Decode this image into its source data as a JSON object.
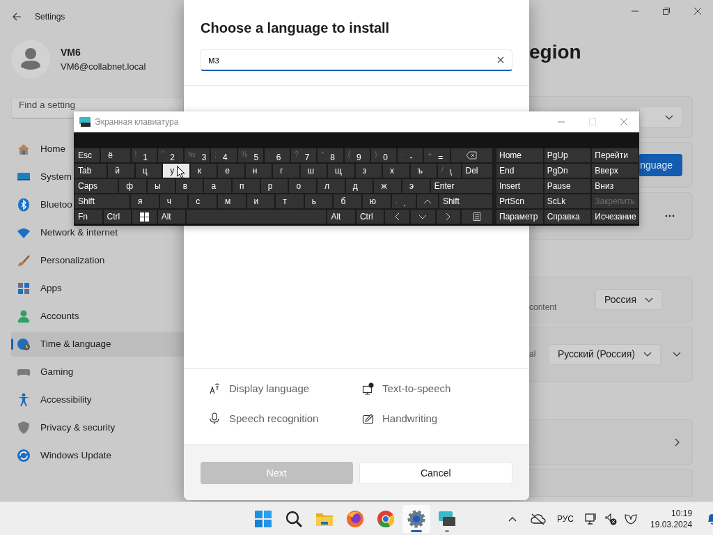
{
  "settings": {
    "title": "Settings",
    "user": {
      "name": "VM6",
      "email": "VM6@collabnet.local"
    },
    "search": {
      "placeholder": "Find a setting"
    },
    "nav": [
      {
        "label": "Home",
        "selected": false
      },
      {
        "label": "System",
        "selected": false
      },
      {
        "label": "Bluetoo",
        "selected": false
      },
      {
        "label": "Network & internet",
        "selected": false
      },
      {
        "label": "Personalization",
        "selected": false
      },
      {
        "label": "Apps",
        "selected": false
      },
      {
        "label": "Accounts",
        "selected": false
      },
      {
        "label": "Time & language",
        "selected": true
      },
      {
        "label": "Gaming",
        "selected": false
      },
      {
        "label": "Accessibility",
        "selected": false
      },
      {
        "label": "Privacy & security",
        "selected": false
      },
      {
        "label": "Windows Update",
        "selected": false
      }
    ],
    "page_title": "egion",
    "groups": [
      [
        {
          "kind": "dropdown"
        },
        {
          "kind": "button",
          "label": "nguage"
        },
        {
          "kind": "more"
        }
      ],
      [
        {
          "kind": "dropdown",
          "label": "content",
          "value": "Россия"
        },
        {
          "kind": "dropdown",
          "label": "al",
          "value": "Русский (Россия)",
          "expandable": true
        }
      ],
      [
        {
          "kind": "link"
        },
        {
          "kind": "blank"
        }
      ]
    ]
  },
  "dialog": {
    "title": "Choose a language to install",
    "search": {
      "value": "мз"
    },
    "features": [
      {
        "label": "Display language"
      },
      {
        "label": "Text-to-speech"
      },
      {
        "label": "Speech recognition"
      },
      {
        "label": "Handwriting"
      }
    ],
    "buttons": [
      {
        "label": "Next",
        "disabled": true
      },
      {
        "label": "Cancel",
        "disabled": false
      }
    ]
  },
  "keyboard": {
    "title": "Экранная клавиатура",
    "rows": [
      [
        {
          "kind": "word",
          "label": "Esc",
          "pressed": false
        },
        {
          "kind": "char",
          "label": "ё",
          "pressed": false
        },
        {
          "kind": "dual",
          "shift": "!",
          "label": "1",
          "pressed": false
        },
        {
          "kind": "dual",
          "shift": "\"",
          "label": "2",
          "pressed": false
        },
        {
          "kind": "dual",
          "shift": "№",
          "label": "3",
          "pressed": false
        },
        {
          "kind": "dual",
          "shift": ";",
          "label": "4",
          "pressed": false
        },
        {
          "kind": "dual",
          "shift": "%",
          "label": "5",
          "pressed": false
        },
        {
          "kind": "dual",
          "shift": ":",
          "label": "6",
          "pressed": false
        },
        {
          "kind": "dual",
          "shift": "?",
          "label": "7",
          "pressed": false
        },
        {
          "kind": "dual",
          "shift": "*",
          "label": "8",
          "pressed": false
        },
        {
          "kind": "dual",
          "shift": "(",
          "label": "9",
          "pressed": false
        },
        {
          "kind": "dual",
          "shift": ")",
          "label": "0",
          "pressed": false
        },
        {
          "kind": "dual",
          "shift": "-",
          "label": "-",
          "pressed": false
        },
        {
          "kind": "dual",
          "shift": "+",
          "label": "=",
          "pressed": false
        },
        {
          "kind": "icon",
          "pressed": false
        }
      ],
      [
        {
          "kind": "word",
          "label": "Tab",
          "pressed": false
        },
        {
          "kind": "char",
          "label": "й",
          "pressed": false
        },
        {
          "kind": "char",
          "label": "ц",
          "pressed": false
        },
        {
          "kind": "char",
          "label": "у",
          "pressed": true
        },
        {
          "kind": "char",
          "label": "к",
          "pressed": false
        },
        {
          "kind": "char",
          "label": "е",
          "pressed": false
        },
        {
          "kind": "char",
          "label": "н",
          "pressed": false
        },
        {
          "kind": "char",
          "label": "г",
          "pressed": false
        },
        {
          "kind": "char",
          "label": "ш",
          "pressed": false
        },
        {
          "kind": "char",
          "label": "щ",
          "pressed": false
        },
        {
          "kind": "char",
          "label": "з",
          "pressed": false
        },
        {
          "kind": "char",
          "label": "х",
          "pressed": false
        },
        {
          "kind": "char",
          "label": "ъ",
          "pressed": false
        },
        {
          "kind": "dual",
          "shift": "/",
          "label": "\\",
          "pressed": false
        },
        {
          "kind": "word",
          "label": "Del",
          "pressed": false
        }
      ],
      [
        {
          "kind": "word",
          "label": "Caps",
          "pressed": false
        },
        {
          "kind": "char",
          "label": "ф",
          "pressed": false
        },
        {
          "kind": "char",
          "label": "ы",
          "pressed": false
        },
        {
          "kind": "char",
          "label": "в",
          "pressed": false
        },
        {
          "kind": "char",
          "label": "а",
          "pressed": false
        },
        {
          "kind": "char",
          "label": "п",
          "pressed": false
        },
        {
          "kind": "char",
          "label": "р",
          "pressed": false
        },
        {
          "kind": "char",
          "label": "о",
          "pressed": false
        },
        {
          "kind": "char",
          "label": "л",
          "pressed": false
        },
        {
          "kind": "char",
          "label": "д",
          "pressed": false
        },
        {
          "kind": "char",
          "label": "ж",
          "pressed": false
        },
        {
          "kind": "char",
          "label": "э",
          "pressed": false
        },
        {
          "kind": "word",
          "label": "Enter",
          "pressed": false
        }
      ],
      [
        {
          "kind": "word",
          "label": "Shift",
          "pressed": false
        },
        {
          "kind": "char",
          "label": "я",
          "pressed": false
        },
        {
          "kind": "char",
          "label": "ч",
          "pressed": false
        },
        {
          "kind": "char",
          "label": "с",
          "pressed": false
        },
        {
          "kind": "char",
          "label": "м",
          "pressed": false
        },
        {
          "kind": "char",
          "label": "и",
          "pressed": false
        },
        {
          "kind": "char",
          "label": "т",
          "pressed": false
        },
        {
          "kind": "char",
          "label": "ь",
          "pressed": false
        },
        {
          "kind": "char",
          "label": "б",
          "pressed": false
        },
        {
          "kind": "char",
          "label": "ю",
          "pressed": false
        },
        {
          "kind": "dual",
          "shift": ",",
          "label": ".",
          "pressed": false
        },
        {
          "kind": "icon",
          "pressed": false
        },
        {
          "kind": "word",
          "label": "Shift",
          "pressed": false
        }
      ],
      [
        {
          "kind": "word",
          "label": "Fn",
          "pressed": false
        },
        {
          "kind": "word",
          "label": "Ctrl",
          "pressed": false
        },
        {
          "kind": "icon",
          "pressed": false
        },
        {
          "kind": "word",
          "label": "Alt",
          "pressed": false
        },
        {
          "kind": "space",
          "pressed": false
        },
        {
          "kind": "word",
          "label": "Alt",
          "pressed": false
        },
        {
          "kind": "word",
          "label": "Ctrl",
          "pressed": false
        },
        {
          "kind": "icon",
          "pressed": false
        },
        {
          "kind": "icon",
          "pressed": false
        },
        {
          "kind": "icon",
          "pressed": false
        },
        {
          "kind": "icon",
          "pressed": false
        }
      ]
    ],
    "nav_keys": [
      {
        "label": "Home",
        "disabled": false
      },
      {
        "label": "PgUp",
        "disabled": false
      },
      {
        "label": "Перейти",
        "disabled": false
      },
      {
        "label": "End",
        "disabled": false
      },
      {
        "label": "PgDn",
        "disabled": false
      },
      {
        "label": "Вверх",
        "disabled": false
      },
      {
        "label": "Insert",
        "disabled": false
      },
      {
        "label": "Pause",
        "disabled": false
      },
      {
        "label": "Вниз",
        "disabled": false
      },
      {
        "label": "PrtScn",
        "disabled": false
      },
      {
        "label": "ScLk",
        "disabled": false
      },
      {
        "label": "Закрепить",
        "disabled": true
      },
      {
        "label": "Параметр",
        "disabled": false
      },
      {
        "label": "Справка",
        "disabled": false
      },
      {
        "label": "Исчезание",
        "disabled": false
      }
    ]
  },
  "taskbar": {
    "apps": [
      {
        "active": false,
        "running": false
      },
      {
        "active": false,
        "running": false
      },
      {
        "active": false,
        "running": false
      },
      {
        "active": false,
        "running": false
      },
      {
        "active": false,
        "running": false
      },
      {
        "active": true,
        "running": true
      },
      {
        "active": false,
        "running": true
      }
    ],
    "language": "РУС",
    "time": "10:19",
    "date": "19.03.2024"
  }
}
